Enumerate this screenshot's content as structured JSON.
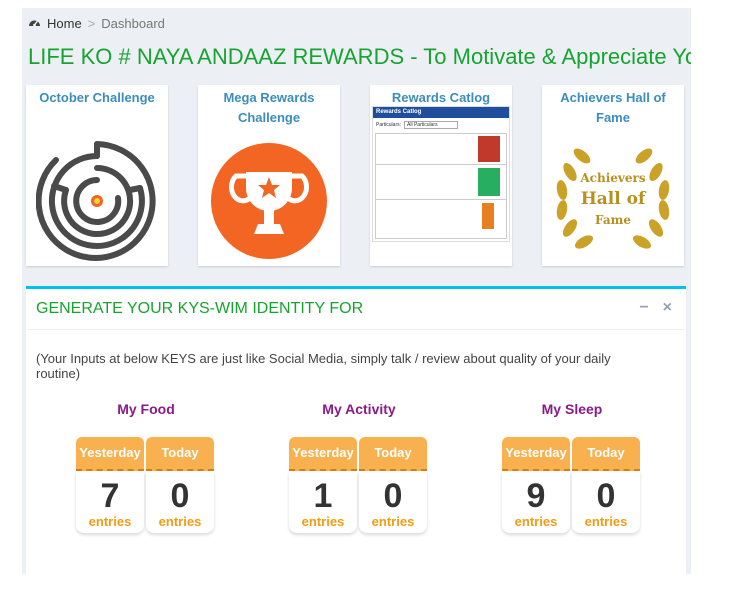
{
  "breadcrumb": {
    "home": "Home",
    "separator": ">",
    "current": "Dashboard"
  },
  "page_title": "LIFE KO # NAYA ANDAAZ REWARDS - To Motivate & Appreciate Your",
  "tiles": [
    {
      "label": "October Challenge",
      "image": "maze-icon"
    },
    {
      "label": "Mega Rewards Challenge",
      "image": "trophy-icon"
    },
    {
      "label": "Rewards Catlog",
      "image": "catalog-thumbnail",
      "thumb_header": "Rewards Catlog",
      "thumb_filter_label": "Particulars:",
      "thumb_filter_value": "All Particulars"
    },
    {
      "label": "Achievers Hall of Fame",
      "image": "laurel-wreath-icon",
      "wreath_text": [
        "Achievers",
        "Hall of",
        "Fame"
      ]
    }
  ],
  "panel": {
    "title": "GENERATE YOUR KYS-WIM IDENTITY FOR",
    "minimize": "−",
    "close": "×",
    "note": "(Your Inputs at below KEYS are just like Social Media, simply talk / review about quality of your daily routine)",
    "groups": [
      {
        "title": "My Food",
        "cells": [
          {
            "head": "Yesterday",
            "count": "7",
            "unit": "entries"
          },
          {
            "head": "Today",
            "count": "0",
            "unit": "entries"
          }
        ]
      },
      {
        "title": "My Activity",
        "cells": [
          {
            "head": "Yesterday",
            "count": "1",
            "unit": "entries"
          },
          {
            "head": "Today",
            "count": "0",
            "unit": "entries"
          }
        ]
      },
      {
        "title": "My Sleep",
        "cells": [
          {
            "head": "Yesterday",
            "count": "9",
            "unit": "entries"
          },
          {
            "head": "Today",
            "count": "0",
            "unit": "entries"
          }
        ]
      }
    ]
  },
  "colors": {
    "title_green": "#18a331",
    "accent_orange": "#f9b04f",
    "trophy_orange": "#f26522",
    "purple": "#8b1a8b",
    "link_blue": "#3c8dbc",
    "gold": "#c9a227"
  }
}
